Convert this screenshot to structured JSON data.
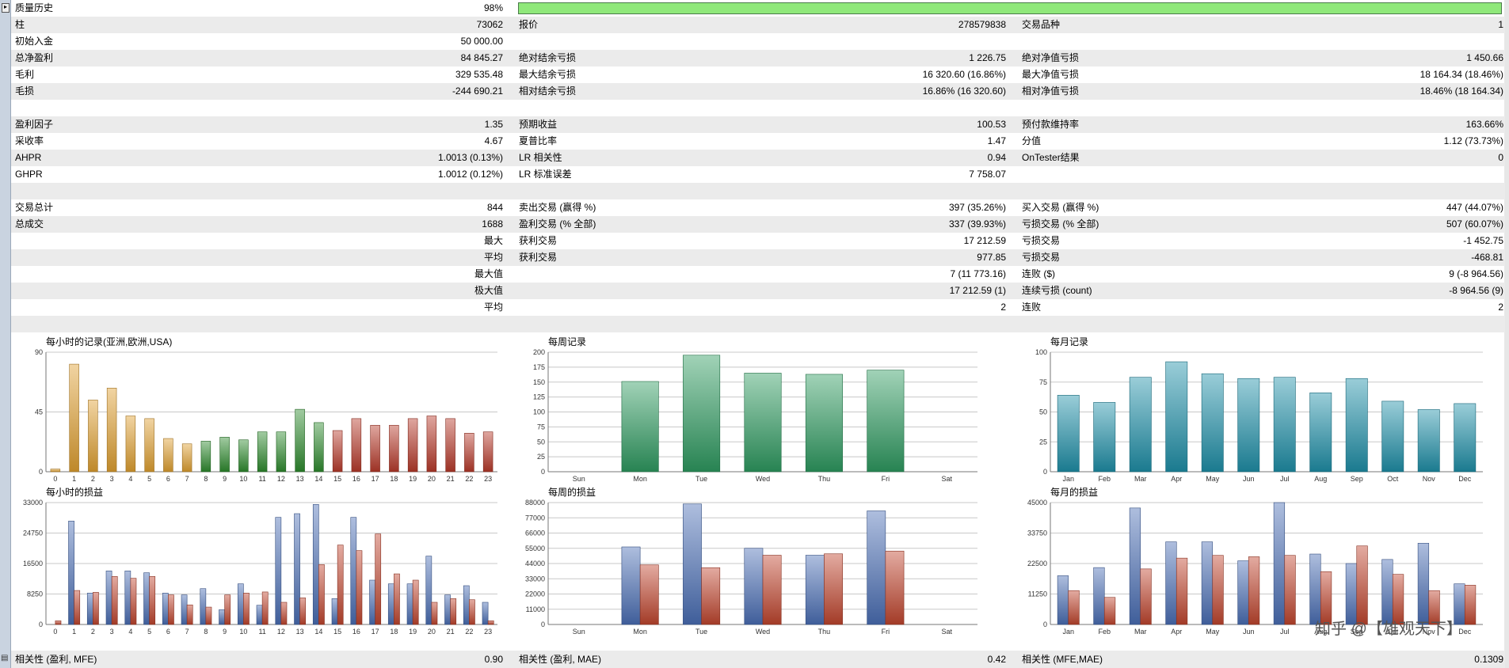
{
  "stats": {
    "quality_history": {
      "label": "质量历史",
      "value": "98%",
      "progress": 1.0
    },
    "rows": [
      {
        "c1": {
          "label": "柱",
          "value": "73062"
        },
        "c2": {
          "label": "报价",
          "value": "278579838"
        },
        "c3": {
          "label": "交易品种",
          "value": "1"
        }
      },
      {
        "c1": {
          "label": "初始入金",
          "value": "50 000.00"
        },
        "c2": {
          "label": "",
          "value": ""
        },
        "c3": {
          "label": "",
          "value": ""
        }
      },
      {
        "c1": {
          "label": "总净盈利",
          "value": "84 845.27"
        },
        "c2": {
          "label": "绝对结余亏损",
          "value": "1 226.75"
        },
        "c3": {
          "label": "绝对净值亏损",
          "value": "1 450.66"
        }
      },
      {
        "c1": {
          "label": "毛利",
          "value": "329 535.48"
        },
        "c2": {
          "label": "最大结余亏损",
          "value": "16 320.60 (16.86%)"
        },
        "c3": {
          "label": "最大净值亏损",
          "value": "18 164.34 (18.46%)"
        }
      },
      {
        "c1": {
          "label": "毛损",
          "value": "-244 690.21"
        },
        "c2": {
          "label": "相对结余亏损",
          "value": "16.86% (16 320.60)"
        },
        "c3": {
          "label": "相对净值亏损",
          "value": "18.46% (18 164.34)"
        }
      },
      {
        "c1": {
          "label": "",
          "value": ""
        },
        "c2": {
          "label": "",
          "value": ""
        },
        "c3": {
          "label": "",
          "value": ""
        }
      },
      {
        "c1": {
          "label": "盈利因子",
          "value": "1.35"
        },
        "c2": {
          "label": "预期收益",
          "value": "100.53"
        },
        "c3": {
          "label": "预付款维持率",
          "value": "163.66%"
        }
      },
      {
        "c1": {
          "label": "采收率",
          "value": "4.67"
        },
        "c2": {
          "label": "夏普比率",
          "value": "1.47"
        },
        "c3": {
          "label": "分值",
          "value": "1.12 (73.73%)"
        }
      },
      {
        "c1": {
          "label": "AHPR",
          "value": "1.0013 (0.13%)"
        },
        "c2": {
          "label": "LR 相关性",
          "value": "0.94"
        },
        "c3": {
          "label": "OnTester结果",
          "value": "0"
        }
      },
      {
        "c1": {
          "label": "GHPR",
          "value": "1.0012 (0.12%)"
        },
        "c2": {
          "label": "LR 标准误差",
          "value": "7 758.07"
        },
        "c3": {
          "label": "",
          "value": ""
        }
      },
      {
        "c1": {
          "label": "",
          "value": ""
        },
        "c2": {
          "label": "",
          "value": ""
        },
        "c3": {
          "label": "",
          "value": ""
        }
      },
      {
        "c1": {
          "label": "交易总计",
          "value": "844"
        },
        "c2": {
          "label": "卖出交易 (赢得 %)",
          "value": "397 (35.26%)"
        },
        "c3": {
          "label": "买入交易 (赢得 %)",
          "value": "447 (44.07%)"
        }
      },
      {
        "c1": {
          "label": "总成交",
          "value": "1688"
        },
        "c2": {
          "label": "盈利交易 (% 全部)",
          "value": "337 (39.93%)"
        },
        "c3": {
          "label": "亏损交易 (% 全部)",
          "value": "507 (60.07%)"
        }
      },
      {
        "c1": {
          "label": "",
          "value": "最大"
        },
        "c2": {
          "label": "获利交易",
          "value": "17 212.59"
        },
        "c3": {
          "label": "亏损交易",
          "value": "-1 452.75"
        }
      },
      {
        "c1": {
          "label": "",
          "value": "平均"
        },
        "c2": {
          "label": "获利交易",
          "value": "977.85"
        },
        "c3": {
          "label": "亏损交易",
          "value": "-468.81"
        }
      },
      {
        "c1": {
          "label": "",
          "value": "最大值"
        },
        "c2": {
          "label": "",
          "value": "7 (11 773.16)"
        },
        "c3": {
          "label": "连败 ($)",
          "value": "9 (-8 964.56)"
        }
      },
      {
        "c1": {
          "label": "",
          "value": "极大值"
        },
        "c2": {
          "label": "",
          "value": "17 212.59 (1)"
        },
        "c3": {
          "label": "连续亏损 (count)",
          "value": "-8 964.56 (9)"
        }
      },
      {
        "c1": {
          "label": "",
          "value": "平均"
        },
        "c2": {
          "label": "",
          "value": "2"
        },
        "c3": {
          "label": "连败",
          "value": "2"
        }
      },
      {
        "c1": {
          "label": "",
          "value": ""
        },
        "c2": {
          "label": "",
          "value": ""
        },
        "c3": {
          "label": "",
          "value": ""
        }
      }
    ]
  },
  "bottom": [
    {
      "label": "相关性 (盈利, MFE)",
      "value": "0.90"
    },
    {
      "label": "相关性 (盈利, MAE)",
      "value": "0.42"
    },
    {
      "label": "相关性 (MFE,MAE)",
      "value": "0.1309"
    }
  ],
  "watermark": "知乎 @【雄观天下】",
  "chart_data": [
    {
      "id": "hourly-entries",
      "type": "bar",
      "title": "每小时的记录(亚洲,欧洲,USA)",
      "categories": [
        "0",
        "1",
        "2",
        "3",
        "4",
        "5",
        "6",
        "7",
        "8",
        "9",
        "10",
        "11",
        "12",
        "13",
        "14",
        "15",
        "16",
        "17",
        "18",
        "19",
        "20",
        "21",
        "22",
        "23"
      ],
      "values": [
        2,
        81,
        54,
        63,
        42,
        40,
        25,
        21,
        23,
        26,
        24,
        30,
        30,
        47,
        37,
        31,
        40,
        35,
        35,
        40,
        42,
        40,
        29,
        30
      ],
      "colors": [
        "#e0a030",
        "#e0a030",
        "#e0a030",
        "#e0a030",
        "#e0a030",
        "#e0a030",
        "#e0a030",
        "#e0a030",
        "#2e8b2e",
        "#2e8b2e",
        "#2e8b2e",
        "#2e8b2e",
        "#2e8b2e",
        "#2e8b2e",
        "#2e8b2e",
        "#b83a2a",
        "#b83a2a",
        "#b83a2a",
        "#b83a2a",
        "#b83a2a",
        "#b83a2a",
        "#b83a2a",
        "#b83a2a",
        "#b83a2a"
      ],
      "yticks": [
        0,
        45,
        90
      ],
      "ylim": [
        0,
        90
      ],
      "grid": true
    },
    {
      "id": "weekly-entries",
      "type": "bar",
      "title": "每周记录",
      "categories": [
        "Sun",
        "Mon",
        "Tue",
        "Wed",
        "Thu",
        "Fri",
        "Sat"
      ],
      "values": [
        0,
        151,
        195,
        165,
        163,
        170,
        0
      ],
      "color": "#2e9a60",
      "yticks": [
        0,
        25,
        50,
        75,
        100,
        125,
        150,
        175,
        200
      ],
      "ylim": [
        0,
        200
      ],
      "grid": true
    },
    {
      "id": "monthly-entries",
      "type": "bar",
      "title": "每月记录",
      "categories": [
        "Jan",
        "Feb",
        "Mar",
        "Apr",
        "May",
        "Jun",
        "Jul",
        "Aug",
        "Sep",
        "Oct",
        "Nov",
        "Dec"
      ],
      "values": [
        64,
        58,
        79,
        92,
        82,
        78,
        79,
        66,
        78,
        59,
        52,
        57
      ],
      "color": "#1e8fa8",
      "yticks": [
        0,
        25,
        50,
        75,
        100
      ],
      "ylim": [
        0,
        100
      ],
      "grid": true
    },
    {
      "id": "hourly-pnl",
      "type": "bar",
      "title": "每小时的损益",
      "categories": [
        "0",
        "1",
        "2",
        "3",
        "4",
        "5",
        "6",
        "7",
        "8",
        "9",
        "10",
        "11",
        "12",
        "13",
        "14",
        "15",
        "16",
        "17",
        "18",
        "19",
        "20",
        "21",
        "22",
        "23"
      ],
      "series": [
        {
          "values": [
            0,
            28000,
            8500,
            14500,
            14500,
            14000,
            8500,
            8000,
            9700,
            4000,
            11000,
            5200,
            29000,
            30000,
            32500,
            7000,
            29000,
            12000,
            11000,
            11000,
            18500,
            8000,
            10500,
            6000
          ],
          "color": "#4a6fb5"
        },
        {
          "values": [
            1000,
            9200,
            8700,
            13000,
            12500,
            13000,
            8000,
            5300,
            4700,
            8000,
            8500,
            8800,
            6000,
            7200,
            16200,
            21500,
            20000,
            24500,
            13700,
            12000,
            6000,
            7000,
            6700,
            1000
          ],
          "color": "#c0452e"
        }
      ],
      "yticks": [
        0,
        8250,
        16500,
        24750,
        33000
      ],
      "ylim": [
        0,
        33000
      ],
      "grid": true
    },
    {
      "id": "weekly-pnl",
      "type": "bar",
      "title": "每周的损益",
      "categories": [
        "Sun",
        "Mon",
        "Tue",
        "Wed",
        "Thu",
        "Fri",
        "Sat"
      ],
      "series": [
        {
          "values": [
            0,
            56000,
            87000,
            55000,
            50000,
            82000,
            0
          ],
          "color": "#4a6fb5"
        },
        {
          "values": [
            0,
            43000,
            41000,
            50000,
            51000,
            53000,
            0
          ],
          "color": "#c0452e"
        }
      ],
      "yticks": [
        0,
        11000,
        22000,
        33000,
        44000,
        55000,
        66000,
        77000,
        88000
      ],
      "ylim": [
        0,
        88000
      ],
      "grid": true
    },
    {
      "id": "monthly-pnl",
      "type": "bar",
      "title": "每月的损益",
      "categories": [
        "Jan",
        "Feb",
        "Mar",
        "Apr",
        "May",
        "Jun",
        "Jul",
        "Aug",
        "Sep",
        "Oct",
        "Nov",
        "Dec"
      ],
      "series": [
        {
          "values": [
            18000,
            21000,
            43000,
            30500,
            30500,
            23500,
            45000,
            26000,
            22500,
            24000,
            30000,
            15000
          ],
          "color": "#4a6fb5"
        },
        {
          "values": [
            12500,
            10000,
            20500,
            24500,
            25500,
            25000,
            25500,
            19500,
            29000,
            18500,
            12500,
            14500
          ],
          "color": "#c0452e"
        }
      ],
      "yticks": [
        0,
        11250,
        22500,
        33750,
        45000
      ],
      "ylim": [
        0,
        45000
      ],
      "grid": true
    }
  ]
}
